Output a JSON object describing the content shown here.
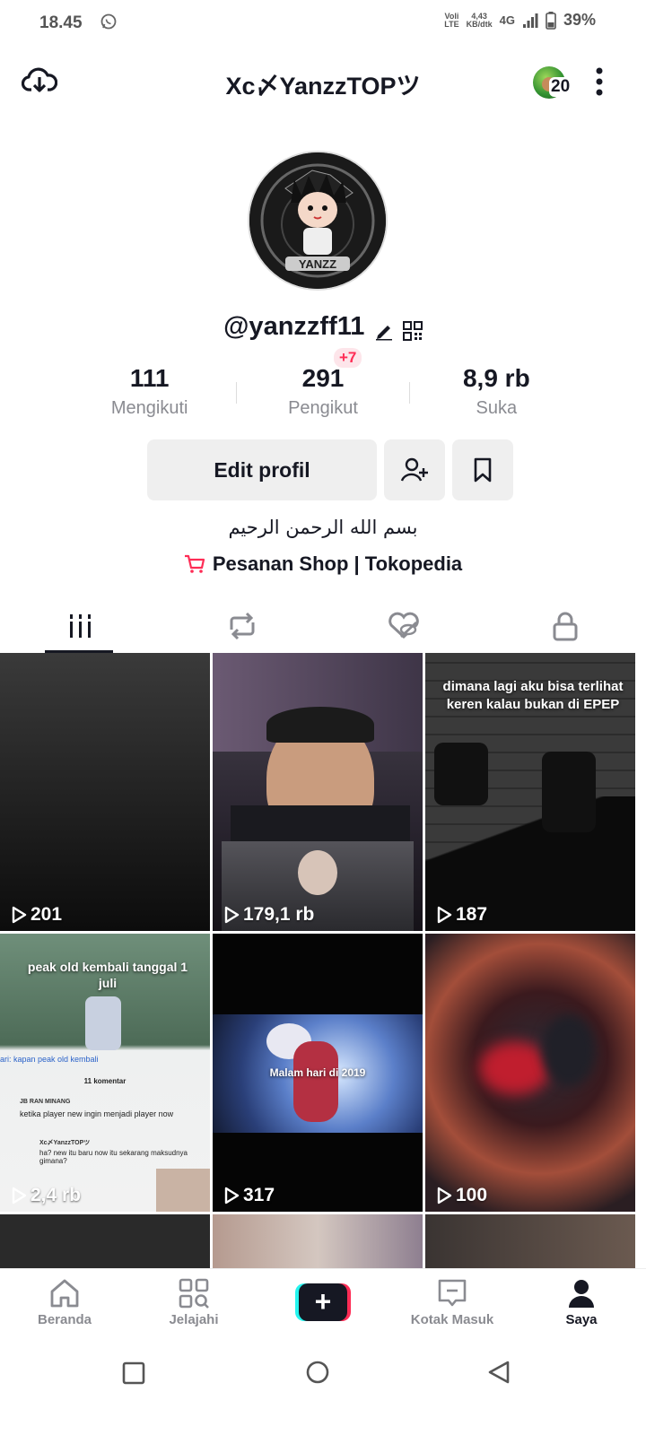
{
  "status_bar": {
    "time": "18.45",
    "volte_top": "Voli",
    "volte_bottom": "LTE",
    "speed_top": "4,43",
    "speed_bottom": "KB/dtk",
    "network": "4G",
    "battery": "39%"
  },
  "header": {
    "title": "Xc〆YanzzTOPツ",
    "notification_count": "20"
  },
  "profile": {
    "avatar_text": "YANZZ",
    "username": "@yanzzff11",
    "stats": [
      {
        "value": "111",
        "label": "Mengikuti"
      },
      {
        "value": "291",
        "label": "Pengikut"
      },
      {
        "value": "8,9 rb",
        "label": "Suka"
      }
    ],
    "new_followers_badge": "+7",
    "edit_button": "Edit profil",
    "bio": "بسم الله الرحمن الرحيم",
    "shop_link": "Pesanan Shop | Tokopedia"
  },
  "tabs": [
    "videos",
    "reposts",
    "liked",
    "private"
  ],
  "videos": [
    {
      "views": "201",
      "caption": ""
    },
    {
      "views": "179,1 rb",
      "caption": ""
    },
    {
      "views": "187",
      "caption_line1": "dimana lagi aku bisa terlihat",
      "caption_line2": "keren kalau bukan di EPEP"
    },
    {
      "views": "2,4 rb",
      "caption": "peak old kembali tanggal 1 juli"
    },
    {
      "views": "317",
      "caption": "Malam hari di 2019"
    },
    {
      "views": "100",
      "caption": ""
    }
  ],
  "video_extra": {
    "search_hint": "ari: kapan peak old kembali",
    "comments_title": "11 komentar",
    "comment1_user": "JB RAN MINANG",
    "comment1_text": "ketika player new ingin menjadi player now",
    "comment2_user": "Xc〆YanzzTOPツ",
    "comment2_text": "ha? new itu baru now itu sekarang maksudnya gimana?"
  },
  "bottom_nav": [
    {
      "label": "Beranda",
      "icon": "home-icon"
    },
    {
      "label": "Jelajahi",
      "icon": "explore-icon"
    },
    {
      "label": "",
      "icon": "plus-icon"
    },
    {
      "label": "Kotak Masuk",
      "icon": "inbox-icon"
    },
    {
      "label": "Saya",
      "icon": "profile-icon"
    }
  ],
  "colors": {
    "accent": "#fe2c55",
    "cyan": "#25f4ee",
    "text": "#161823",
    "muted": "#8a8b91"
  }
}
